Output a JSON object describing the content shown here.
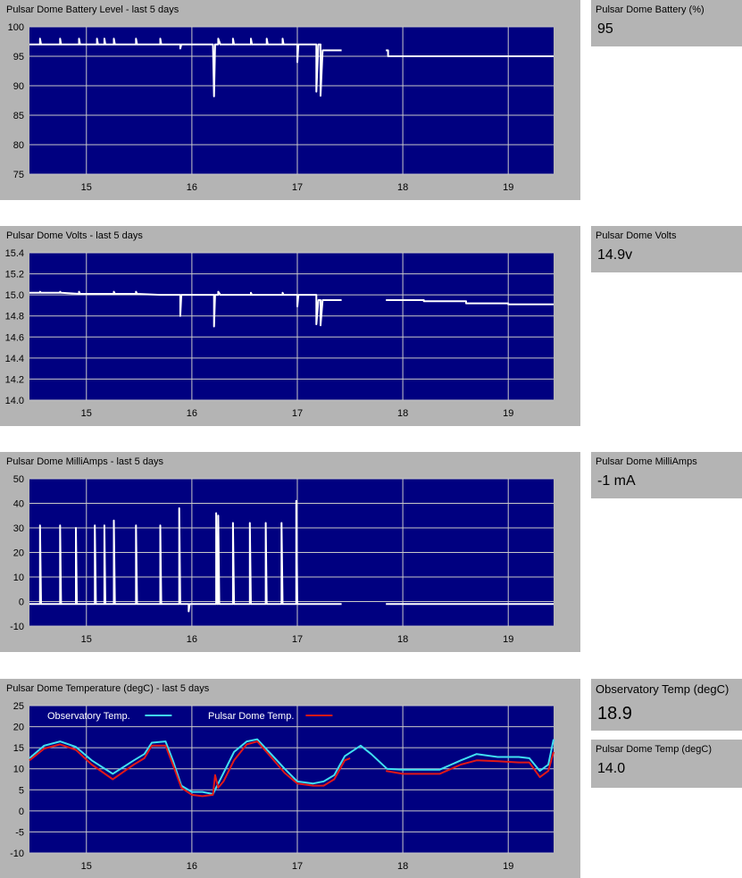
{
  "stats": [
    {
      "label": "Pulsar Dome Battery (%)",
      "value": "95"
    },
    {
      "label": "Pulsar Dome Volts",
      "value": "14.9v"
    },
    {
      "label": "Pulsar Dome MilliAmps",
      "value": "-1 mA"
    },
    {
      "label": "Observatory Temp (degC)",
      "value": "18.9"
    },
    {
      "label": "Pulsar Dome Temp (degC)",
      "value": "14.0"
    }
  ],
  "colors": {
    "plot_bg": "#000080",
    "panel_bg": "#b4b4b4",
    "grid": "#c8c8c8",
    "series_white": "#ffffff",
    "series_cyan": "#40e0f0",
    "series_red": "#e01818"
  },
  "chart_data": [
    {
      "type": "line",
      "title": "Pulsar Dome Battery Level - last 5 days",
      "xlabel": "",
      "ylabel": "",
      "xlim": [
        14.46,
        19.43
      ],
      "ylim": [
        75,
        100
      ],
      "xticks": [
        15,
        16,
        17,
        18,
        19
      ],
      "yticks": [
        75,
        80,
        85,
        90,
        95,
        100
      ],
      "grid": true,
      "series": [
        {
          "color": "#ffffff",
          "points": [
            [
              14.46,
              97
            ],
            [
              14.56,
              97
            ],
            [
              14.56,
              98
            ],
            [
              14.57,
              97
            ],
            [
              14.75,
              97
            ],
            [
              14.75,
              98
            ],
            [
              14.76,
              97
            ],
            [
              14.93,
              97
            ],
            [
              14.93,
              98
            ],
            [
              14.94,
              97
            ],
            [
              15.1,
              97
            ],
            [
              15.1,
              98
            ],
            [
              15.11,
              97
            ],
            [
              15.17,
              97
            ],
            [
              15.17,
              98
            ],
            [
              15.18,
              97
            ],
            [
              15.26,
              97
            ],
            [
              15.26,
              98
            ],
            [
              15.27,
              97
            ],
            [
              15.47,
              97
            ],
            [
              15.47,
              98
            ],
            [
              15.48,
              97
            ],
            [
              15.7,
              97
            ],
            [
              15.7,
              98
            ],
            [
              15.71,
              97
            ],
            [
              15.89,
              97
            ],
            [
              15.89,
              96.3
            ],
            [
              15.9,
              97
            ],
            [
              16.2,
              97
            ],
            [
              16.21,
              88.2
            ],
            [
              16.22,
              97
            ],
            [
              16.25,
              97
            ],
            [
              16.25,
              98
            ],
            [
              16.27,
              97
            ],
            [
              16.39,
              97
            ],
            [
              16.39,
              98
            ],
            [
              16.4,
              97
            ],
            [
              16.56,
              97
            ],
            [
              16.56,
              98
            ],
            [
              16.57,
              97
            ],
            [
              16.71,
              97
            ],
            [
              16.71,
              98
            ],
            [
              16.72,
              97
            ],
            [
              16.86,
              97
            ],
            [
              16.86,
              98
            ],
            [
              16.87,
              97
            ],
            [
              17.0,
              97
            ],
            [
              17.0,
              94
            ],
            [
              17.01,
              97
            ],
            [
              17.18,
              97
            ],
            [
              17.18,
              89
            ],
            [
              17.2,
              97
            ],
            [
              17.22,
              97
            ],
            [
              17.22,
              88.3
            ],
            [
              17.24,
              96
            ],
            [
              17.42,
              96
            ]
          ]
        },
        {
          "color": "#ffffff",
          "points": [
            [
              17.84,
              96
            ],
            [
              17.86,
              96
            ],
            [
              17.86,
              95
            ],
            [
              19.43,
              95
            ]
          ]
        }
      ]
    },
    {
      "type": "line",
      "title": "Pulsar Dome Volts - last 5 days",
      "xlabel": "",
      "ylabel": "",
      "xlim": [
        14.46,
        19.43
      ],
      "ylim": [
        14.0,
        15.4
      ],
      "xticks": [
        15,
        16,
        17,
        18,
        19
      ],
      "yticks": [
        14.0,
        14.2,
        14.4,
        14.6,
        14.8,
        15.0,
        15.2,
        15.4
      ],
      "grid": true,
      "series": [
        {
          "color": "#ffffff",
          "points": [
            [
              14.46,
              15.02
            ],
            [
              14.56,
              15.02
            ],
            [
              14.56,
              15.03
            ],
            [
              14.57,
              15.02
            ],
            [
              14.75,
              15.02
            ],
            [
              14.75,
              15.03
            ],
            [
              14.76,
              15.02
            ],
            [
              14.93,
              15.01
            ],
            [
              14.93,
              15.03
            ],
            [
              14.94,
              15.01
            ],
            [
              15.26,
              15.01
            ],
            [
              15.26,
              15.03
            ],
            [
              15.27,
              15.01
            ],
            [
              15.47,
              15.01
            ],
            [
              15.47,
              15.03
            ],
            [
              15.48,
              15.01
            ],
            [
              15.7,
              15.0
            ],
            [
              15.89,
              15.0
            ],
            [
              15.89,
              14.8
            ],
            [
              15.9,
              15.0
            ],
            [
              16.21,
              15.0
            ],
            [
              16.21,
              14.7
            ],
            [
              16.22,
              15.0
            ],
            [
              16.25,
              15.0
            ],
            [
              16.25,
              15.03
            ],
            [
              16.27,
              15.0
            ],
            [
              16.56,
              15.0
            ],
            [
              16.56,
              15.02
            ],
            [
              16.57,
              15.0
            ],
            [
              16.86,
              15.0
            ],
            [
              16.86,
              15.02
            ],
            [
              16.87,
              15.0
            ],
            [
              17.0,
              15.0
            ],
            [
              17.0,
              14.89
            ],
            [
              17.01,
              15.0
            ],
            [
              17.18,
              15.0
            ],
            [
              17.18,
              14.72
            ],
            [
              17.2,
              14.95
            ],
            [
              17.22,
              14.95
            ],
            [
              17.22,
              14.71
            ],
            [
              17.24,
              14.95
            ],
            [
              17.42,
              14.95
            ]
          ]
        },
        {
          "color": "#ffffff",
          "points": [
            [
              17.84,
              14.95
            ],
            [
              18.2,
              14.95
            ],
            [
              18.2,
              14.94
            ],
            [
              18.6,
              14.94
            ],
            [
              18.6,
              14.92
            ],
            [
              19.0,
              14.92
            ],
            [
              19.0,
              14.91
            ],
            [
              19.43,
              14.91
            ]
          ]
        }
      ]
    },
    {
      "type": "line",
      "title": "Pulsar Dome MilliAmps - last 5 days",
      "xlabel": "",
      "ylabel": "",
      "xlim": [
        14.46,
        19.43
      ],
      "ylim": [
        -10,
        50
      ],
      "xticks": [
        15,
        16,
        17,
        18,
        19
      ],
      "yticks": [
        -10,
        0,
        10,
        20,
        30,
        40,
        50
      ],
      "grid": true,
      "series": [
        {
          "color": "#ffffff",
          "points": [
            [
              14.46,
              -1
            ],
            [
              14.56,
              -1
            ],
            [
              14.56,
              31
            ],
            [
              14.57,
              -1
            ],
            [
              14.75,
              -1
            ],
            [
              14.75,
              31
            ],
            [
              14.76,
              -1
            ],
            [
              14.9,
              -1
            ],
            [
              14.9,
              30
            ],
            [
              14.91,
              -1
            ],
            [
              15.08,
              -1
            ],
            [
              15.08,
              31
            ],
            [
              15.09,
              -1
            ],
            [
              15.17,
              -1
            ],
            [
              15.17,
              31
            ],
            [
              15.18,
              -1
            ],
            [
              15.26,
              -1
            ],
            [
              15.26,
              33
            ],
            [
              15.27,
              -1
            ],
            [
              15.47,
              -1
            ],
            [
              15.47,
              31
            ],
            [
              15.48,
              -1
            ],
            [
              15.7,
              -1
            ],
            [
              15.7,
              31
            ],
            [
              15.71,
              -1
            ],
            [
              15.88,
              -1
            ],
            [
              15.88,
              38
            ],
            [
              15.89,
              -1
            ],
            [
              15.97,
              -1
            ],
            [
              15.97,
              -4
            ],
            [
              15.98,
              -1
            ],
            [
              16.23,
              -1
            ],
            [
              16.23,
              36
            ],
            [
              16.24,
              -1
            ],
            [
              16.25,
              -1
            ],
            [
              16.25,
              35
            ],
            [
              16.26,
              -1
            ],
            [
              16.39,
              -1
            ],
            [
              16.39,
              32
            ],
            [
              16.4,
              -1
            ],
            [
              16.55,
              -1
            ],
            [
              16.55,
              32
            ],
            [
              16.56,
              -1
            ],
            [
              16.7,
              -1
            ],
            [
              16.7,
              32
            ],
            [
              16.71,
              -1
            ],
            [
              16.85,
              -1
            ],
            [
              16.85,
              32
            ],
            [
              16.86,
              -1
            ],
            [
              16.99,
              -1
            ],
            [
              16.99,
              41
            ],
            [
              17.0,
              -1
            ],
            [
              17.42,
              -1
            ]
          ]
        },
        {
          "color": "#ffffff",
          "points": [
            [
              17.84,
              -1
            ],
            [
              19.43,
              -1
            ]
          ]
        }
      ]
    },
    {
      "type": "line",
      "title": "Pulsar Dome Temperature (degC) - last 5 days",
      "xlabel": "",
      "ylabel": "",
      "xlim": [
        14.46,
        19.43
      ],
      "ylim": [
        -10,
        25
      ],
      "xticks": [
        15,
        16,
        17,
        18,
        19
      ],
      "yticks": [
        -10,
        -5,
        0,
        5,
        10,
        15,
        20,
        25
      ],
      "grid": true,
      "legend": "top-left",
      "series": [
        {
          "name": "Observatory Temp.",
          "color": "#40e0f0",
          "points": [
            [
              14.46,
              12.5
            ],
            [
              14.6,
              15.5
            ],
            [
              14.75,
              16.5
            ],
            [
              14.9,
              15.2
            ],
            [
              15.05,
              12.0
            ],
            [
              15.25,
              8.8
            ],
            [
              15.45,
              12.0
            ],
            [
              15.55,
              13.5
            ],
            [
              15.62,
              16.2
            ],
            [
              15.75,
              16.5
            ],
            [
              15.82,
              12.0
            ],
            [
              15.9,
              6.0
            ],
            [
              16.0,
              4.5
            ],
            [
              16.1,
              4.5
            ],
            [
              16.2,
              4.0
            ],
            [
              16.28,
              8.0
            ],
            [
              16.4,
              14.0
            ],
            [
              16.52,
              16.5
            ],
            [
              16.62,
              17.0
            ],
            [
              16.75,
              13.5
            ],
            [
              16.88,
              10.0
            ],
            [
              17.0,
              7.0
            ],
            [
              17.15,
              6.5
            ],
            [
              17.25,
              7.0
            ],
            [
              17.35,
              8.5
            ],
            [
              17.45,
              13.0
            ],
            [
              17.6,
              15.5
            ],
            [
              17.7,
              13.5
            ],
            [
              17.85,
              10.0
            ],
            [
              18.0,
              9.8
            ],
            [
              18.35,
              9.8
            ],
            [
              18.55,
              12.0
            ],
            [
              18.7,
              13.5
            ],
            [
              18.9,
              12.8
            ],
            [
              19.1,
              12.8
            ],
            [
              19.2,
              12.5
            ],
            [
              19.3,
              9.5
            ],
            [
              19.38,
              11.0
            ],
            [
              19.43,
              17.0
            ]
          ]
        },
        {
          "name": "Pulsar Dome Temp.",
          "color": "#e01818",
          "points": [
            [
              14.46,
              12.0
            ],
            [
              14.6,
              14.8
            ],
            [
              14.75,
              15.8
            ],
            [
              14.9,
              14.5
            ],
            [
              15.05,
              11.0
            ],
            [
              15.25,
              7.5
            ],
            [
              15.45,
              11.0
            ],
            [
              15.55,
              12.5
            ],
            [
              15.62,
              15.5
            ],
            [
              15.75,
              15.5
            ],
            [
              15.82,
              11.0
            ],
            [
              15.9,
              5.5
            ],
            [
              16.0,
              3.8
            ],
            [
              16.1,
              3.5
            ],
            [
              16.2,
              3.8
            ],
            [
              16.22,
              8.5
            ],
            [
              16.25,
              5.5
            ],
            [
              16.3,
              7.0
            ],
            [
              16.4,
              12.0
            ],
            [
              16.52,
              15.8
            ],
            [
              16.62,
              16.5
            ],
            [
              16.75,
              12.8
            ],
            [
              16.88,
              9.0
            ],
            [
              17.0,
              6.5
            ],
            [
              17.15,
              6.0
            ],
            [
              17.25,
              6.0
            ],
            [
              17.35,
              7.5
            ],
            [
              17.45,
              12.0
            ],
            [
              17.5,
              12.5
            ]
          ]
        },
        {
          "color": "#e01818",
          "points": [
            [
              17.84,
              9.5
            ],
            [
              18.0,
              8.8
            ],
            [
              18.35,
              8.8
            ],
            [
              18.55,
              11.0
            ],
            [
              18.7,
              12.0
            ],
            [
              18.9,
              11.8
            ],
            [
              19.1,
              11.5
            ],
            [
              19.2,
              11.5
            ],
            [
              19.3,
              8.0
            ],
            [
              19.38,
              9.5
            ],
            [
              19.43,
              14.0
            ]
          ]
        }
      ]
    }
  ]
}
